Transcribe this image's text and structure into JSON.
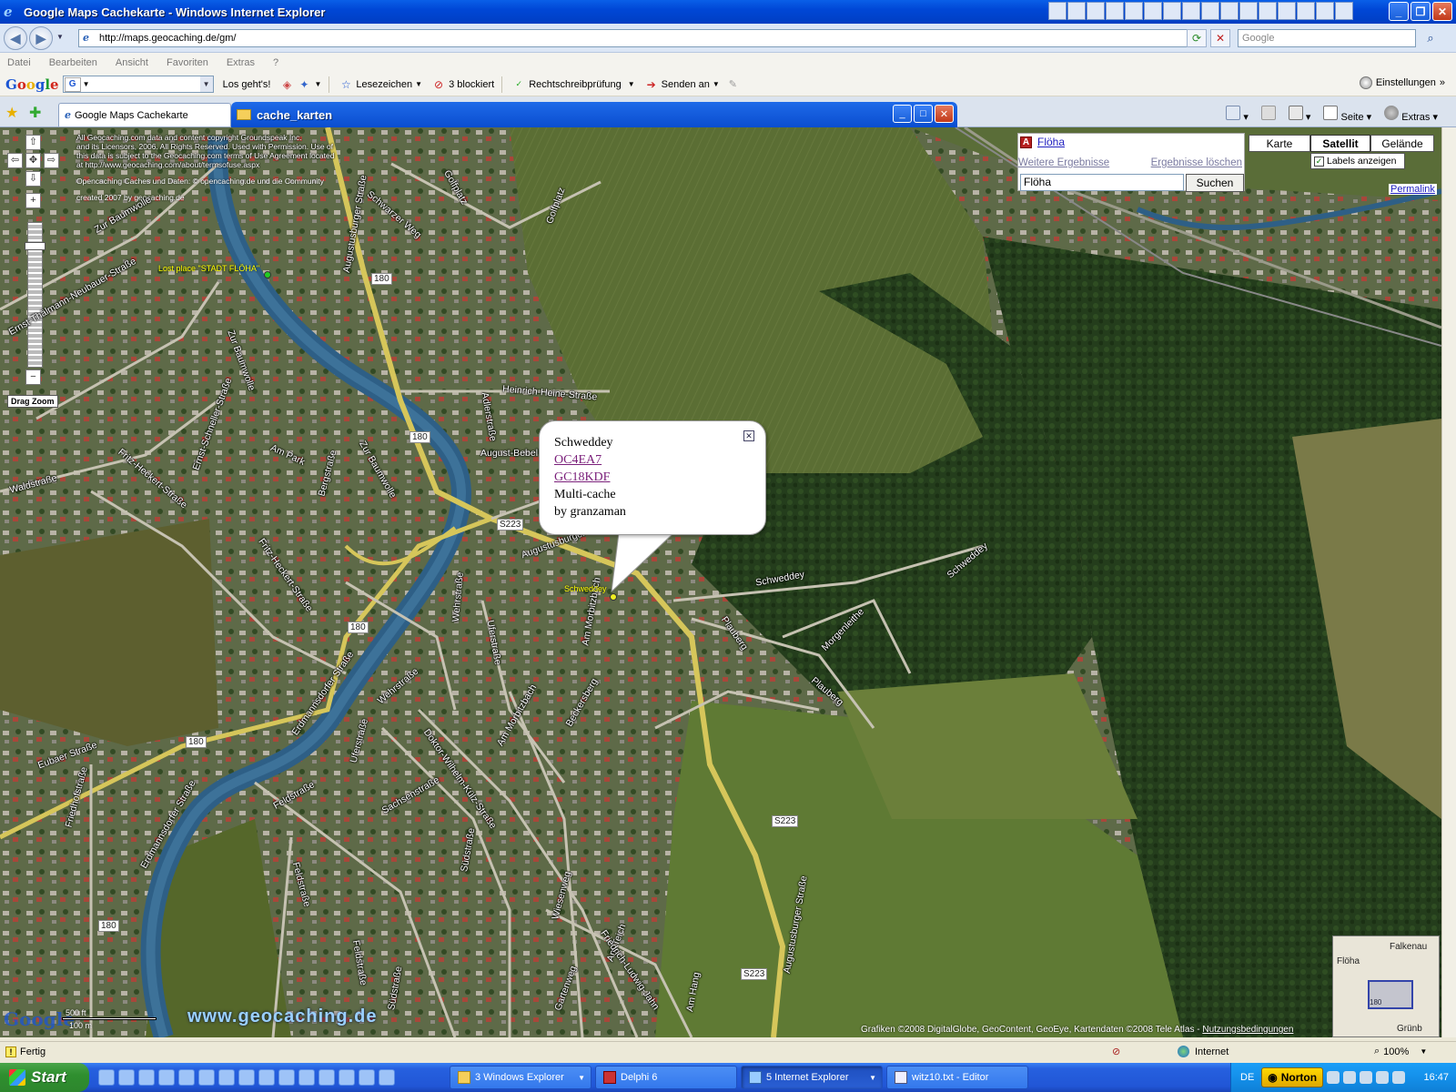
{
  "window": {
    "title": "Google Maps Cachekarte - Windows Internet Explorer",
    "url": "http://maps.geocaching.de/gm/",
    "search_placeholder": "Google"
  },
  "menu": [
    "Datei",
    "Bearbeiten",
    "Ansicht",
    "Favoriten",
    "Extras",
    "?"
  ],
  "google_toolbar": {
    "logo": [
      "G",
      "o",
      "o",
      "g",
      "l",
      "e"
    ],
    "g_button": "G",
    "los": "Los geht's!",
    "lesezeichen": "Lesezeichen",
    "blocked": "3 blockiert",
    "spell": "Rechtschreibprüfung",
    "send": "Senden an",
    "settings": "Einstellungen"
  },
  "tabs": {
    "active_tab": "Google Maps Cachekarte",
    "explorer_window": "cache_karten",
    "home": "",
    "page": "Seite",
    "extras": "Extras"
  },
  "map": {
    "copyright_lines": [
      "All Geocaching.com data and content copyright Groundspeak Inc.",
      "and its Licensors, 2006. All Rights Reserved. Used with Permission. Use of",
      "this data is subject to the Geocaching.com terms of Use Agreement located",
      "at http://www.geocaching.com/about/termsofuse.aspx"
    ],
    "oc_copyright": "Opencaching Caches und Daten: © opencaching.de und die Community",
    "created": "created 2007 by geocaching.de",
    "drag_zoom": "Drag Zoom",
    "search_result": "Flöha",
    "search_result_marker": "A",
    "more_results": "Weitere Ergebnisse",
    "clear_results": "Ergebnisse löschen",
    "query": "Flöha",
    "search_button": "Suchen",
    "map_types": [
      "Karte",
      "Satellit",
      "Gelände"
    ],
    "active_type": "Satellit",
    "labels_toggle": "Labels anzeigen",
    "labels_checked": true,
    "permalink": "Permalink",
    "lost_place": "Lost place \"STADT FLÖHA\"",
    "schweddey_marker": "Schweddey",
    "popup": {
      "name": "Schweddey",
      "code1": "OC4EA7",
      "code2": "GC18KDF",
      "type": "Multi-cache",
      "owner": "by granzaman"
    },
    "road_shields": [
      "180",
      "180",
      "180",
      "180",
      "180",
      "S223",
      "S223",
      "S223"
    ],
    "streets": [
      "Augustusburger Straße",
      "Schwarzer Weg",
      "Golfplatz",
      "Golfplatz",
      "Zur Baumwolle",
      "Ernst-Thälmann-Neubauer-Straße",
      "Zur Baumwolle",
      "Heinrich-Heine-Straße",
      "Adlerstraße",
      "August-Bebel",
      "Ernst-Schneller-Straße",
      "Am Park",
      "Bergstraße",
      "Zur Baumwolle",
      "Waldstraße",
      "Fritz-Heckert-Straße",
      "Fritz-Heckert-Straße",
      "Augustusburger Straße",
      "Wehrstraße",
      "Uferstraße",
      "Am Morbitzbach",
      "Schweddey",
      "Schweddey",
      "Plauberg",
      "Morgenleithe",
      "Plauberg",
      "Erdmannsdorfer Straße",
      "Wehrstraße",
      "Uferstraße",
      "Am Morbitzbach",
      "Beckersberg",
      "Doktor-Wilhelm-Külz-Straße",
      "Eubaer Straße",
      "Friedhofstraße",
      "Erdmannsdorfer Straße",
      "Feldstraße",
      "Sachsenstraße",
      "Südstraße",
      "Feldstraße",
      "Feldstraße",
      "Südstraße",
      "Wiesenweg",
      "Am Teich",
      "Friedrich-Ludwig-Jahn",
      "Gartenweg",
      "Am Hang",
      "Augustusburger Straße"
    ],
    "scale": [
      "500 ft",
      "100 m"
    ],
    "google": "Google",
    "gc_url": "www.geocaching.de",
    "attribution": "Grafiken ©2008 DigitalGlobe, GeoContent, GeoEye, Kartendaten ©2008 Tele Atlas -",
    "terms": "Nutzungsbedingungen",
    "overview": [
      "Flöha",
      "Falkenau",
      "Grünb",
      "180"
    ]
  },
  "status": {
    "text": "Fertig",
    "zone": "Internet",
    "zoom": "100%"
  },
  "taskbar": {
    "start": "Start",
    "tasks": [
      "3 Windows Explorer",
      "Delphi 6",
      "5 Internet Explorer",
      "witz10.txt - Editor"
    ],
    "lang": "DE",
    "norton": "Norton",
    "time": "16:47"
  },
  "colors": {
    "xp_blue": "#0a5fe8",
    "road_yellow": "#d6c65a",
    "river_blue": "#2e5f86",
    "forest": "#22391a",
    "field": "#5c7233"
  }
}
